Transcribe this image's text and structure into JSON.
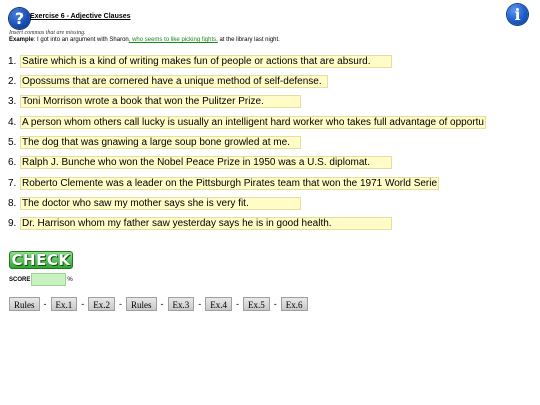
{
  "header": {
    "help_icon_glyph": "?",
    "info_icon_glyph": "i",
    "title": "Exercise 6 - Adjective Clauses",
    "instructions": "Insert commas that are missing.",
    "example_label": "Example",
    "example_before": ": I got into an argument with Sharon",
    "example_clause": ", who seems to like picking fights,",
    "example_after": " at the library last night."
  },
  "questions": [
    {
      "number": "1.",
      "value": "Satire which is a kind of writing makes fun of people or actions that are absurd."
    },
    {
      "number": "2.",
      "value": "Opossums that are cornered have a unique method of self-defense."
    },
    {
      "number": "3.",
      "value": "Toni Morrison wrote a book that won the Pulitzer Prize."
    },
    {
      "number": "4.",
      "value": "A person whom others call lucky is usually an intelligent hard worker who takes full advantage of opportu"
    },
    {
      "number": "5.",
      "value": "The dog that was gnawing a large soup bone growled at me."
    },
    {
      "number": "6.",
      "value": "Ralph J. Bunche who won the Nobel Peace Prize in 1950 was a U.S. diplomat."
    },
    {
      "number": "7.",
      "value": "Roberto Clemente was a leader on the Pittsburgh Pirates team that won the 1971 World Serie"
    },
    {
      "number": "8.",
      "value": "The doctor who saw my mother says she is very fit."
    },
    {
      "number": "9.",
      "value": "Dr. Harrison whom my father saw yesterday says he is in good health."
    }
  ],
  "check_label": "CHECK",
  "score": {
    "label": "SCORE",
    "value": "",
    "suffix": "%"
  },
  "nav": {
    "buttons": [
      "Rules",
      "Ex.1",
      "Ex.2",
      "Rules",
      "Ex.3",
      "Ex.4",
      "Ex.5",
      "Ex.6"
    ],
    "separator": "-"
  },
  "colors": {
    "input_bg": "#fffcc8",
    "check_green": "#2fa52f",
    "score_bg": "#c8f2c0",
    "icon_blue": "#1a4fb8"
  }
}
